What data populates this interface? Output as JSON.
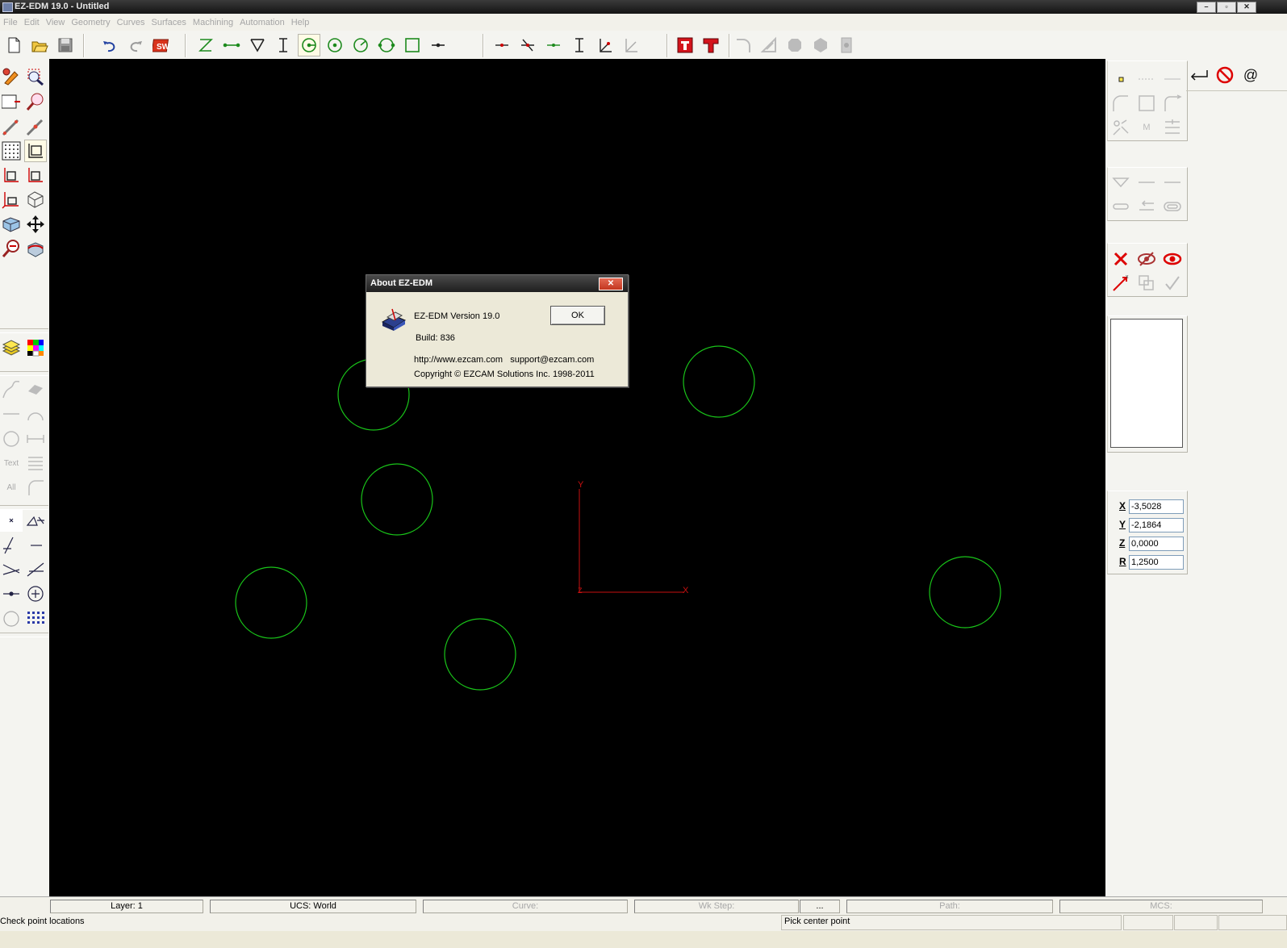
{
  "window": {
    "title": "EZ-EDM 19.0 - Untitled",
    "minimize": "–",
    "restore": "▫",
    "close": "✕"
  },
  "menu": [
    "File",
    "Edit",
    "View",
    "Geometry",
    "Curves",
    "Surfaces",
    "Machining",
    "Automation",
    "Help"
  ],
  "left_toolbar": {
    "text_label": "Text",
    "all_label": "All"
  },
  "right_panel": {
    "at_symbol": "@",
    "m_label": "M",
    "coordinates": [
      {
        "label": "X",
        "value": "-3,5028"
      },
      {
        "label": "Y",
        "value": "-2,1864"
      },
      {
        "label": "Z",
        "value": "0,0000"
      },
      {
        "label": "R",
        "value": "1,2500"
      }
    ]
  },
  "canvas": {
    "background": "#000000",
    "geometry_color": "#19c419",
    "axis_color": "#c81010",
    "axis_labels": {
      "y": "Y",
      "x": "X",
      "z": "Z"
    },
    "circle_count": 6
  },
  "dialog": {
    "title": "About EZ-EDM",
    "close": "✕",
    "version": "EZ-EDM Version 19.0",
    "build": "Build: 836",
    "links": "http://www.ezcam.com   support@ezcam.com",
    "copyright": "Copyright © EZCAM Solutions Inc. 1998-2011",
    "ok_label": "OK"
  },
  "status_bar": {
    "layer": "Layer: 1",
    "ucs": "UCS: World",
    "curve": "Curve:",
    "wk_step": "Wk Step:",
    "ellipsis": "...",
    "path": "Path:",
    "mcs": "MCS:",
    "left_message": "Check point locations",
    "right_message": "Pick center point"
  }
}
